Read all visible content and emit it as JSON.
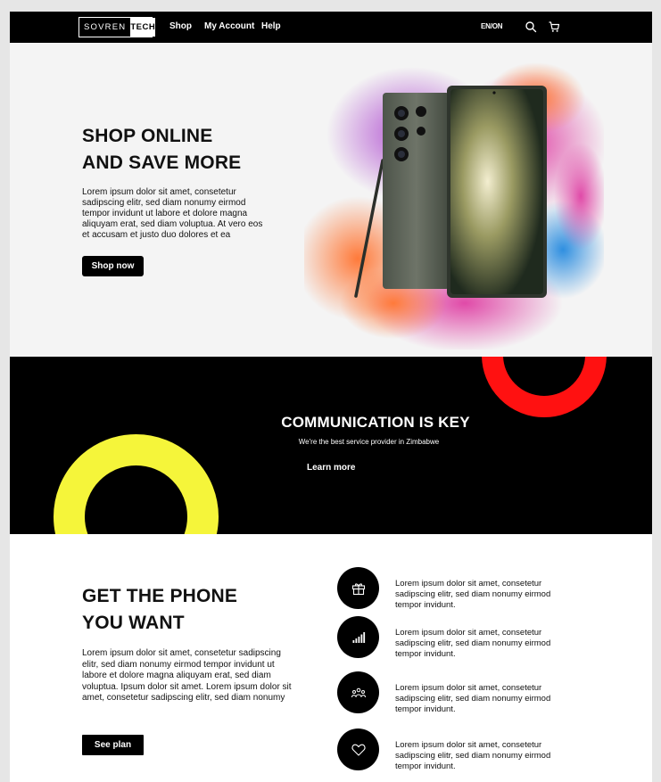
{
  "nav": {
    "logo_left": "SOVREN",
    "logo_right": "TECH",
    "links": [
      "Shop",
      "My Account",
      "Help"
    ],
    "language": "EN/ON"
  },
  "hero": {
    "title_line1": "SHOP ONLINE",
    "title_line2": "AND SAVE MORE",
    "body": "Lorem ipsum dolor sit amet, consetetur sadipscing elitr, sed diam nonumy eirmod tempor invidunt ut labore et dolore magna aliquyam erat, sed diam voluptua. At vero eos et accusam et justo duo dolores et ea",
    "cta": "Shop now"
  },
  "band": {
    "title": "COMMUNICATION IS KEY",
    "subtitle": "We're the best service provider in Zimbabwe",
    "link": "Learn more"
  },
  "plans": {
    "title_line1": "GET THE PHONE",
    "title_line2": "YOU WANT",
    "body": "Lorem ipsum dolor sit amet, consetetur sadipscing elitr, sed diam nonumy eirmod tempor invidunt ut labore et dolore magna aliquyam erat, sed diam voluptua. Ipsum dolor sit amet. Lorem ipsum dolor sit amet, consetetur sadipscing elitr, sed diam nonumy",
    "cta": "See plan",
    "features": [
      {
        "icon": "gift-icon",
        "text": "Lorem ipsum dolor sit amet, consetetur sadipscing elitr, sed diam nonumy eirmod tempor invidunt."
      },
      {
        "icon": "signal-icon",
        "text": "Lorem ipsum dolor sit amet, consetetur sadipscing elitr, sed diam nonumy eirmod tempor invidunt."
      },
      {
        "icon": "people-icon",
        "text": "Lorem ipsum dolor sit amet, consetetur sadipscing elitr, sed diam nonumy eirmod tempor invidunt."
      },
      {
        "icon": "heart-icon",
        "text": "Lorem ipsum dolor sit amet, consetetur sadipscing elitr, sed diam nonumy eirmod tempor invidunt."
      }
    ]
  },
  "colors": {
    "accent_red": "#ff1111",
    "accent_yellow": "#f5f53a",
    "dark": "#000000",
    "hero_bg": "#f4f4f4"
  }
}
